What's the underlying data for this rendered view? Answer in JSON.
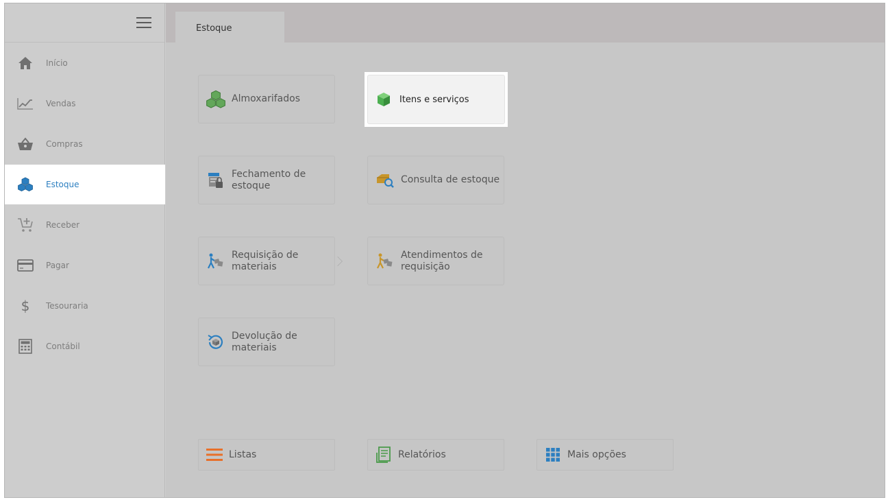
{
  "sidebar": {
    "items": [
      {
        "label": "Início",
        "icon": "home-icon"
      },
      {
        "label": "Vendas",
        "icon": "chart-line-icon"
      },
      {
        "label": "Compras",
        "icon": "shopping-basket-icon"
      },
      {
        "label": "Estoque",
        "icon": "boxes-icon",
        "active": true
      },
      {
        "label": "Receber",
        "icon": "cart-plus-icon"
      },
      {
        "label": "Pagar",
        "icon": "credit-card-icon"
      },
      {
        "label": "Tesouraria",
        "icon": "dollar-icon"
      },
      {
        "label": "Contábil",
        "icon": "calculator-icon"
      }
    ]
  },
  "tabs": [
    {
      "label": "Estoque"
    }
  ],
  "tiles": {
    "almoxarifados": "Almoxarifados",
    "itens_servicos": "Itens e serviços",
    "fechamento_l1": "Fechamento de",
    "fechamento_l2": "estoque",
    "consulta": "Consulta de estoque",
    "requisicao_l1": "Requisição de",
    "requisicao_l2": "materiais",
    "atendimentos_l1": "Atendimentos de",
    "atendimentos_l2": "requisição",
    "devolucao_l1": "Devolução de",
    "devolucao_l2": "materiais"
  },
  "bottom": {
    "listas": "Listas",
    "relatorios": "Relatórios",
    "mais_opcoes": "Mais opções"
  },
  "colors": {
    "accent": "#2c7fc0",
    "green": "#5cb85c",
    "orange": "#e8702a",
    "gold": "#c8962b"
  }
}
